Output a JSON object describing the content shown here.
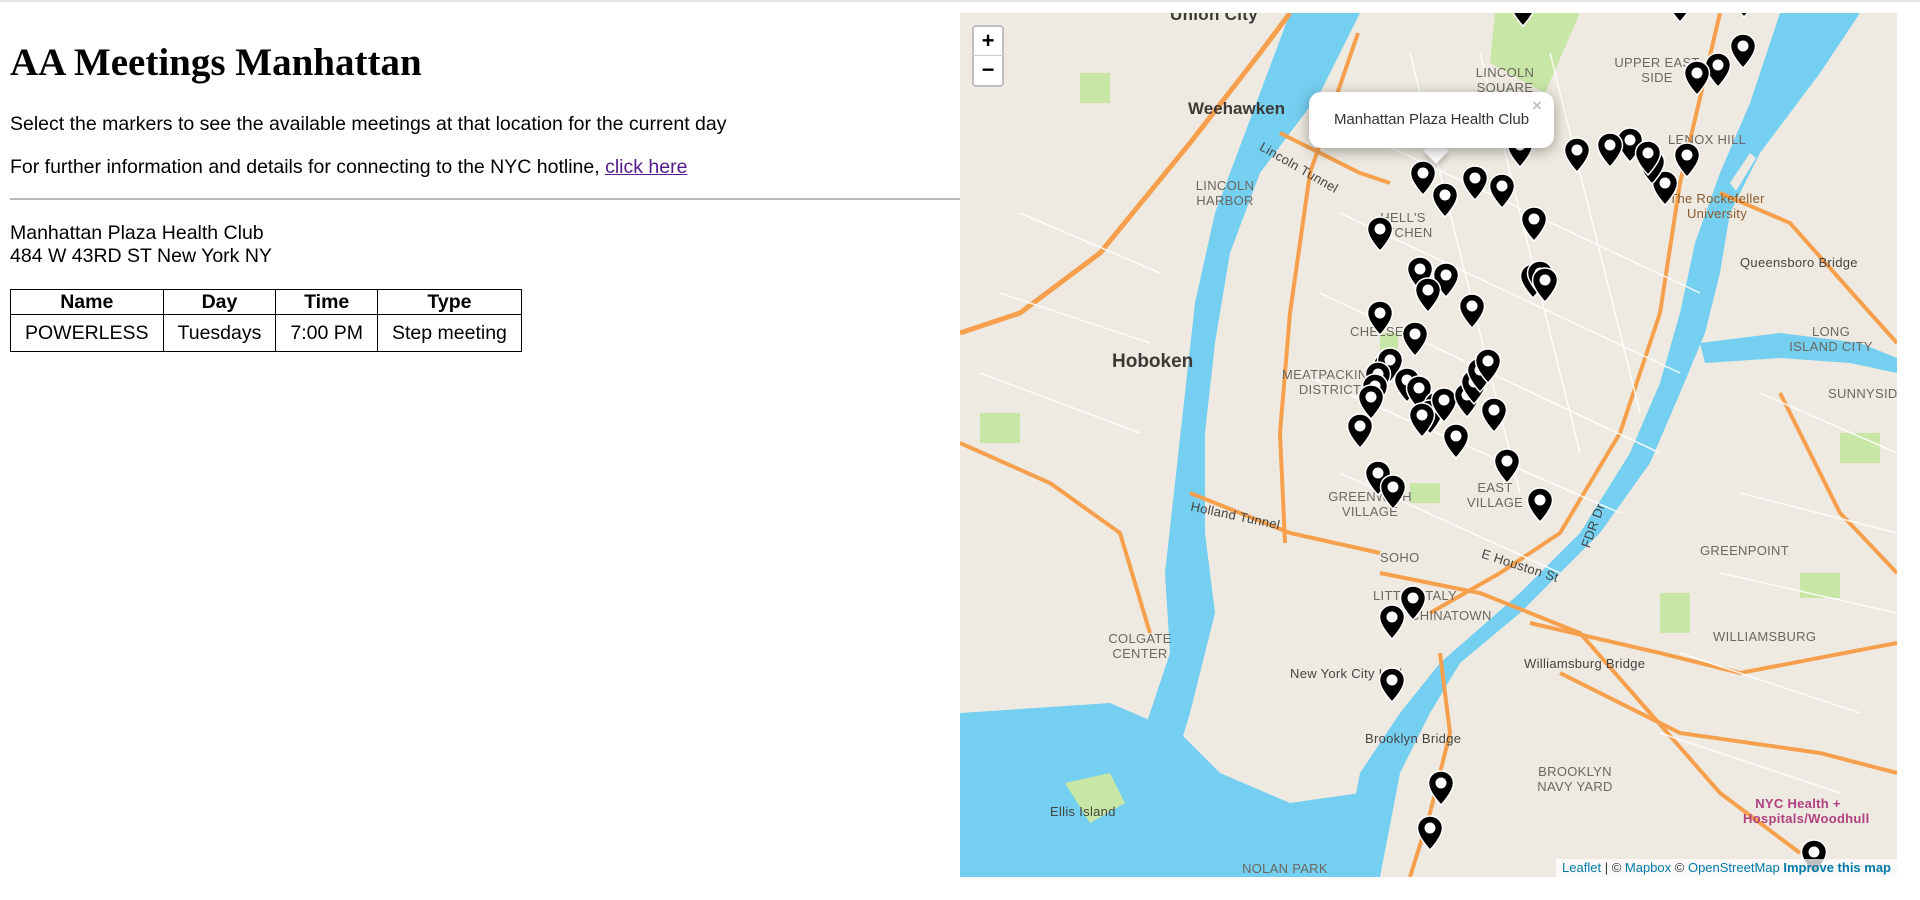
{
  "page": {
    "title": "AA Meetings Manhattan",
    "instruction": "Select the markers to see the available meetings at that location for the current day",
    "hotline_text": "For further information and details for connecting to the NYC hotline, ",
    "hotline_link": "click here"
  },
  "location": {
    "name": "Manhattan Plaza Health Club",
    "address": "484 W 43RD ST New York NY"
  },
  "table": {
    "headers": [
      "Name",
      "Day",
      "Time",
      "Type"
    ],
    "rows": [
      [
        "POWERLESS",
        "Tuesdays",
        "7:00 PM",
        "Step meeting"
      ]
    ]
  },
  "map": {
    "zoom_in": "+",
    "zoom_out": "−",
    "popup_text": "Manhattan Plaza Health Club",
    "popup_close": "×",
    "attribution": {
      "leaflet": "Leaflet",
      "sep1": " | © ",
      "mapbox": "Mapbox",
      "sep2": " © ",
      "osm": "OpenStreetMap",
      "improve": "Improve this map"
    },
    "labels": {
      "union_city": "Union City",
      "weehawken": "Weehawken",
      "hoboken": "Hoboken",
      "lincoln_harbor": "LINCOLN HARBOR",
      "lincoln_square": "LINCOLN SQUARE",
      "upper_east_side": "UPPER EAST SIDE",
      "lenox_hill": "LENOX HILL",
      "rockefeller": "The Rockefeller University",
      "hells_kitchen": "HELL'S KITCHEN",
      "chelsea": "CHELSEA",
      "meatpacking": "MEATPACKING DISTRICT",
      "greenwich": "GREENWICH VILLAGE",
      "east_village": "EAST VILLAGE",
      "soho": "SOHO",
      "little_italy": "LITTLE ITALY",
      "chinatown": "CHINATOWN",
      "city_hall": "New York City Hall",
      "brooklyn_bridge": "Brooklyn Bridge",
      "williamsburg_bridge": "Williamsburg Bridge",
      "williamsburg": "WILLIAMSBURG",
      "greenpoint": "GREENPOINT",
      "lic": "LONG ISLAND CITY",
      "sunnyside": "SUNNYSIDE",
      "queensboro": "Queensboro Bridge",
      "colgate": "COLGATE CENTER",
      "ellis": "Ellis Island",
      "navy_yard": "BROOKLYN NAVY YARD",
      "nyc_health": "NYC Health + Hospitals/Woodhull",
      "holland_tunnel": "Holland Tunnel",
      "lincoln_tunnel": "Lincoln Tunnel",
      "fdr": "FDR Dr",
      "houston": "E Houston St",
      "nolan_park": "NOLAN PARK"
    },
    "marker_count": 58
  },
  "colors": {
    "water": "#75cff0",
    "land": "#eeeae1",
    "park": "#c8e6a5",
    "highway": "#f6a04d",
    "marker": "#000000",
    "link": "#551a8b"
  }
}
